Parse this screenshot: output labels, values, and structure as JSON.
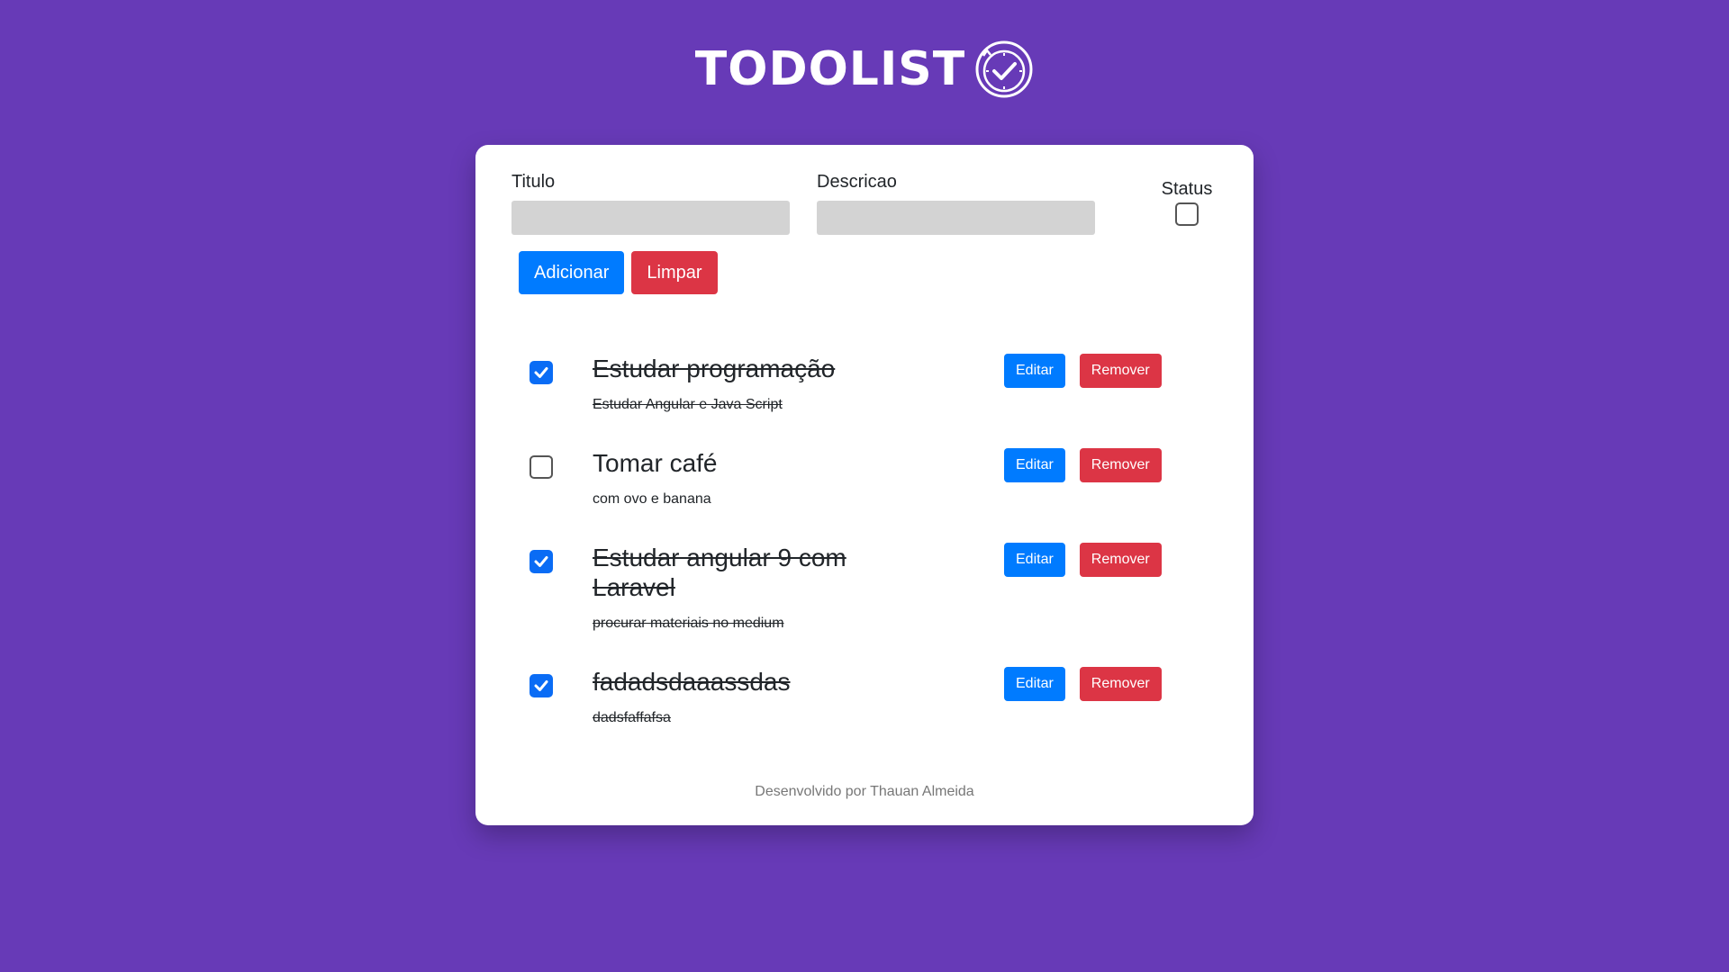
{
  "header": {
    "logo_text": "TODOLIST",
    "logo_icon": "clock-check-icon"
  },
  "form": {
    "title_label": "Titulo",
    "title_value": "",
    "description_label": "Descricao",
    "description_value": "",
    "status_label": "Status",
    "status_checked": false,
    "add_label": "Adicionar",
    "clear_label": "Limpar"
  },
  "todos": [
    {
      "title": "Estudar programação",
      "description": "Estudar Angular e Java Script",
      "done": true,
      "edit_label": "Editar",
      "remove_label": "Remover"
    },
    {
      "title": "Tomar café",
      "description": "com ovo e banana",
      "done": false,
      "edit_label": "Editar",
      "remove_label": "Remover"
    },
    {
      "title": "Estudar angular 9 com Laravel",
      "description": "procurar materiais no medium",
      "done": true,
      "edit_label": "Editar",
      "remove_label": "Remover"
    },
    {
      "title": "fadadsdaaassdas",
      "description": "dadsfaffafsa",
      "done": true,
      "edit_label": "Editar",
      "remove_label": "Remover"
    }
  ],
  "footer": {
    "text": "Desenvolvido por Thauan Almeida"
  },
  "colors": {
    "background": "#673ab7",
    "primary": "#007bff",
    "danger": "#dc3545",
    "checkbox_checked": "#0a6cf5"
  }
}
